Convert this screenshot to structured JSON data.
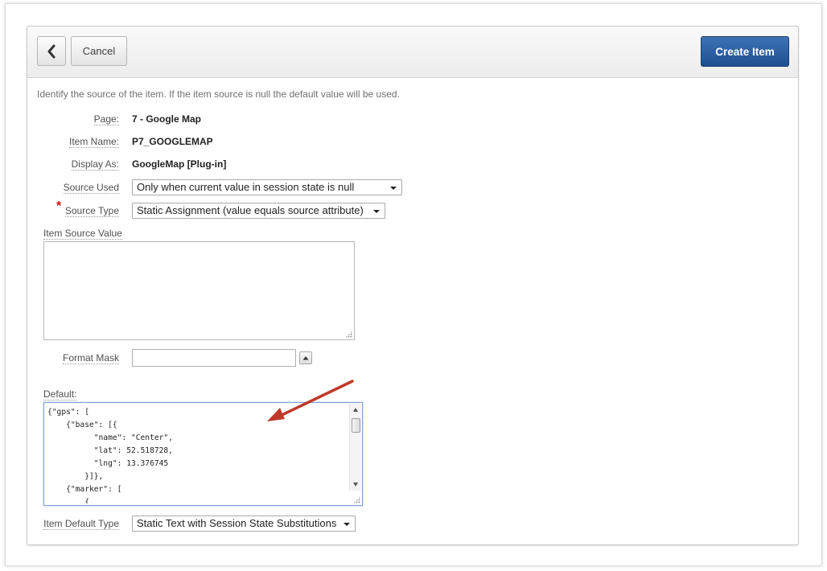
{
  "toolbar": {
    "back_icon": "chevron-left-icon",
    "cancel_label": "Cancel",
    "create_label": "Create Item",
    "create_color": "#2a5fa3"
  },
  "intro_text": "Identify the source of the item. If the item source is null the default value will be used.",
  "fields": {
    "page": {
      "label": "Page:",
      "value": "7 - Google Map"
    },
    "item_name": {
      "label": "Item Name:",
      "value": "P7_GOOGLEMAP"
    },
    "display_as": {
      "label": "Display As:",
      "value": "GoogleMap [Plug-in]"
    },
    "source_used": {
      "label": "Source Used",
      "value": "Only when current value in session state is null"
    },
    "source_type": {
      "label": "Source Type",
      "required_mark": "*",
      "value": "Static Assignment (value equals source attribute)"
    },
    "item_source_value": {
      "label": "Item Source Value",
      "value": ""
    },
    "format_mask": {
      "label": "Format Mask",
      "value": "",
      "popup_icon": "chevron-up-icon"
    },
    "default": {
      "label": "Default:",
      "value": "{\"gps\": [\n    {\"base\": [{\n          \"name\": \"Center\",\n          \"lat\": 52.518728,\n          \"lng\": 13.376745\n        }]},\n    {\"marker\": [\n        {"
    },
    "item_default_type": {
      "label": "Item Default Type",
      "value": "Static Text with Session State Substitutions"
    }
  },
  "annotation": {
    "arrow_icon": "arrow-icon",
    "arrow_color": "#c0392b"
  }
}
